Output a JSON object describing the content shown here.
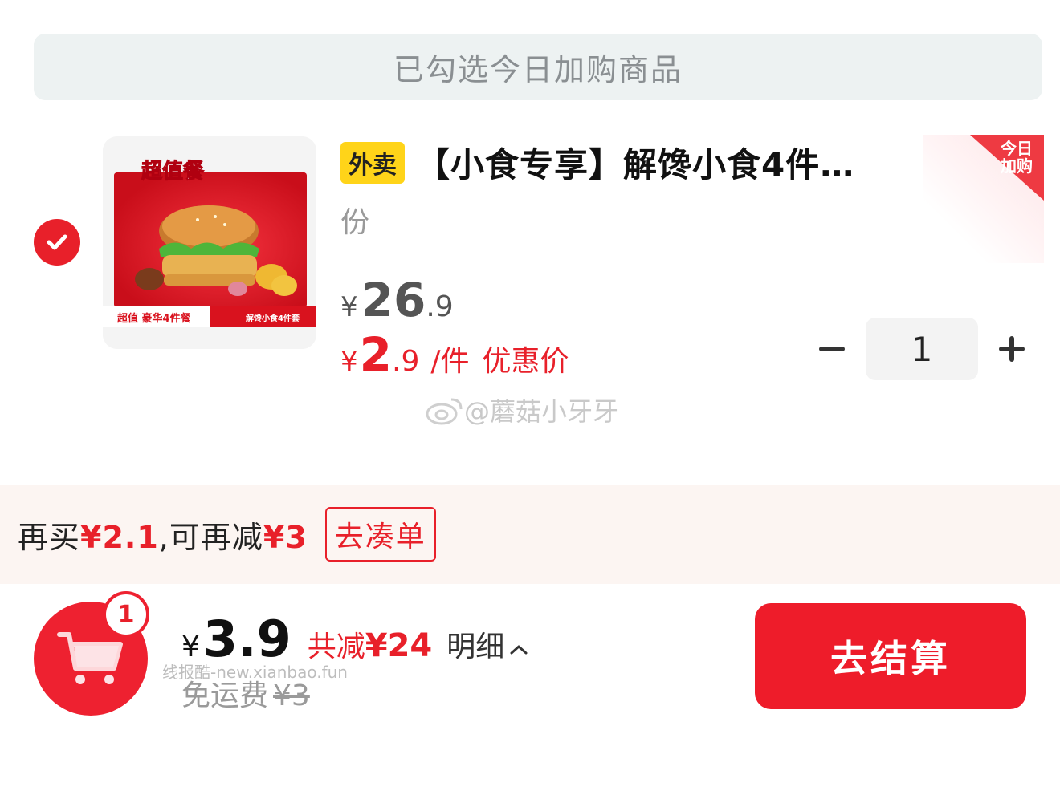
{
  "notice": {
    "text": "已勾选今日加购商品"
  },
  "product": {
    "badge_corner": "今日加购",
    "tag": "外卖",
    "title": "【小食专享】解馋小食4件…",
    "title_continued": "份",
    "thumbnail": {
      "top_label": "超值餐",
      "bottom_left": "超值 豪华4件餐",
      "bottom_right": "解馋小食4件套"
    },
    "original_price": {
      "currency": "¥",
      "integer": "26",
      "decimal": ".9"
    },
    "promo_price": {
      "currency": "¥",
      "integer": "2",
      "decimal": ".9",
      "unit": "/件",
      "label": "优惠价"
    },
    "quantity": "1"
  },
  "watermark": {
    "text": "@蘑菇小牙牙",
    "secondary": "线报酷-new.xianbao.fun"
  },
  "addon": {
    "prefix": "再买",
    "amount": "¥2.1",
    "middle": ",可再减",
    "discount": "¥3",
    "button": "去凑单"
  },
  "cart": {
    "count": "1",
    "currency": "¥",
    "total": "3.9",
    "saved_prefix": "共减",
    "saved_amount": "¥24",
    "detail_label": "明细",
    "shipping_label": "免运费",
    "shipping_original": "¥3",
    "checkout_label": "去结算"
  },
  "colors": {
    "accent": "#e8202a",
    "tag_yellow": "#ffd419",
    "notice_bg": "#edf2f2",
    "addon_bg": "#fcf5f2"
  }
}
